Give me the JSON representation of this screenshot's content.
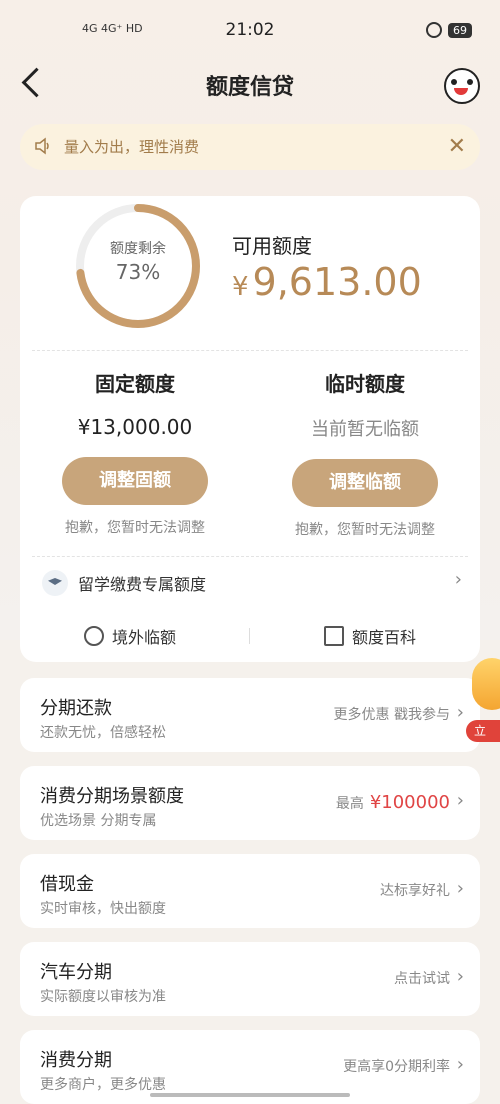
{
  "status_bar": {
    "signal": "4G 4G⁺ HD",
    "time": "21:02",
    "battery": "69"
  },
  "header": {
    "title": "额度信贷"
  },
  "notice": {
    "text": "量入为出，理性消费"
  },
  "credit": {
    "ring_label": "额度剩余",
    "ring_percent": "73%",
    "ring_fraction": 0.73,
    "available_title": "可用额度",
    "currency": "¥",
    "available_amount": "9,613.00",
    "fixed": {
      "title": "固定额度",
      "value": "¥13,000.00",
      "button": "调整固额",
      "hint": "抱歉，您暂时无法调整"
    },
    "temporary": {
      "title": "临时额度",
      "value": "当前暂无临额",
      "button": "调整临额",
      "hint": "抱歉，您暂时无法调整"
    },
    "study_label": "留学缴费专属额度",
    "tools": {
      "overseas": "境外临额",
      "wiki": "额度百科"
    }
  },
  "list": [
    {
      "title": "分期还款",
      "subtitle": "还款无忧，倍感轻松",
      "right": "更多优惠 戳我参与"
    },
    {
      "title": "消费分期场景额度",
      "subtitle": "优选场景 分期专属",
      "right": "最高",
      "right_value": "¥100000"
    },
    {
      "title": "借现金",
      "subtitle": "实时审核，快出额度",
      "right": "达标享好礼"
    },
    {
      "title": "汽车分期",
      "subtitle": "实际额度以审核为准",
      "right": "点击试试"
    },
    {
      "title": "消费分期",
      "subtitle": "更多商户，更多优惠",
      "right": "更高享0分期利率"
    }
  ],
  "float_tag": {
    "text": "立"
  },
  "colors": {
    "accent": "#c8a57b",
    "accent_text": "#b78a57",
    "red": "#e04545",
    "notice_bg": "#fbf2df"
  }
}
